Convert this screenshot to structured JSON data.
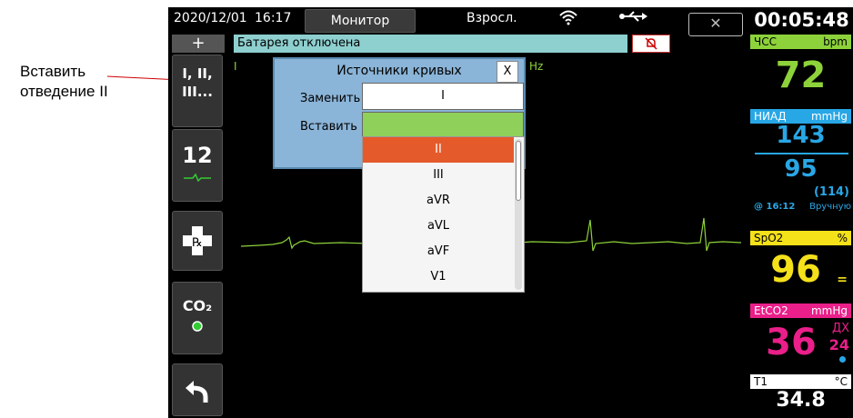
{
  "annotation": {
    "line1": "Вставить",
    "line2": "отведение II"
  },
  "topbar": {
    "date": "2020/12/01",
    "time": "16:17",
    "mode": "Монитор",
    "patient": "Взросл.",
    "elapsed": "00:05:48"
  },
  "status": {
    "message": "Батарея отключена"
  },
  "left_buttons": {
    "plus": "+",
    "leads": "I, II, III...",
    "ecg12": "12",
    "co2": "CO₂"
  },
  "waveform_label": "I",
  "hz_label": "Hz",
  "dialog": {
    "title": "Источники кривых",
    "close": "X",
    "replace_label": "Заменить",
    "replace_value": "I",
    "insert_label": "Вставить",
    "options": [
      "II",
      "III",
      "aVR",
      "aVL",
      "aVF",
      "V1"
    ],
    "selected": "II"
  },
  "vitals": {
    "hr": {
      "label": "ЧСС",
      "unit": "bpm",
      "value": "72"
    },
    "nibp": {
      "label": "НИАД",
      "unit": "mmHg",
      "sys": "143",
      "dia": "95",
      "map": "(114)",
      "time": "@ 16:12",
      "mode": "Вручную"
    },
    "spo2": {
      "label": "SpO2",
      "unit": "%",
      "value": "96",
      "extra": "="
    },
    "etco2": {
      "label": "EtCO2",
      "unit": "mmHg",
      "value": "36",
      "rr_label": "ДХ",
      "rr": "24"
    },
    "temp": {
      "label": "T1",
      "unit": "°C",
      "value": "34.8"
    }
  },
  "colors": {
    "hr": "#8dd23a",
    "nibp": "#28a7e6",
    "spo2": "#f5e11a",
    "etco2": "#ea1f8a",
    "status": "#8ecfcf",
    "selected": "#e55a2b",
    "insert_field": "#8fd05a"
  }
}
